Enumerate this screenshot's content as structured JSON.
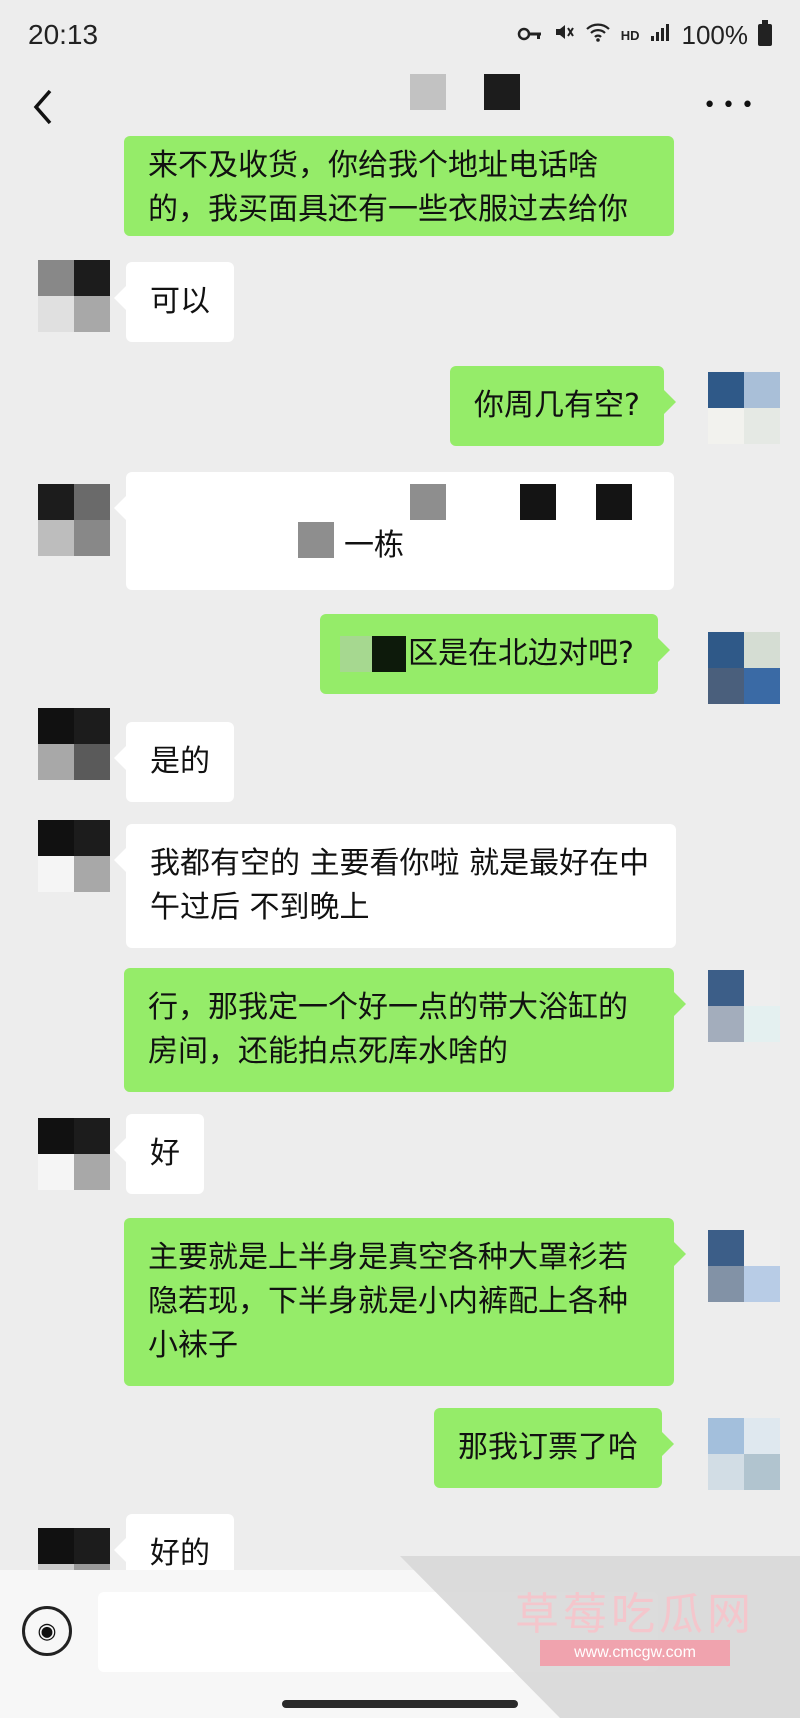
{
  "status_bar": {
    "time": "20:13",
    "network_label": "HD",
    "battery": "100%",
    "icons": [
      "key-icon",
      "mute-icon",
      "wifi-icon",
      "signal-icon",
      "battery-icon"
    ]
  },
  "nav": {
    "back_icon": "chevron-left-icon",
    "more_icon": "more-icon",
    "more_glyph": "•••"
  },
  "messages": [
    {
      "side": "out",
      "text": "来不及收货，你给我个地址电话啥的，我买面具还有一些衣服过去给你"
    },
    {
      "side": "in",
      "text": "可以"
    },
    {
      "side": "out",
      "text": "你周几有空?"
    },
    {
      "side": "in",
      "text": "一栋"
    },
    {
      "side": "out",
      "text": "区是在北边对吧?"
    },
    {
      "side": "in",
      "text": "是的"
    },
    {
      "side": "in",
      "text": "我都有空的 主要看你啦 就是最好在中午过后 不到晚上"
    },
    {
      "side": "out",
      "text": "行，那我定一个好一点的带大浴缸的房间，还能拍点死库水啥的"
    },
    {
      "side": "in",
      "text": "好"
    },
    {
      "side": "out",
      "text": "主要就是上半身是真空各种大罩衫若隐若现，下半身就是小内裤配上各种小袜子"
    },
    {
      "side": "out",
      "text": "那我订票了哈"
    },
    {
      "side": "in",
      "text": "好的"
    }
  ],
  "input": {
    "voice_icon": "voice-icon",
    "voice_glyph": "◉",
    "text_value": ""
  },
  "watermark": {
    "text": "草莓吃瓜网",
    "url": "www.cmcgw.com"
  },
  "colors": {
    "background": "#ededed",
    "outgoing_bubble": "#95ec69",
    "incoming_bubble": "#ffffff"
  }
}
